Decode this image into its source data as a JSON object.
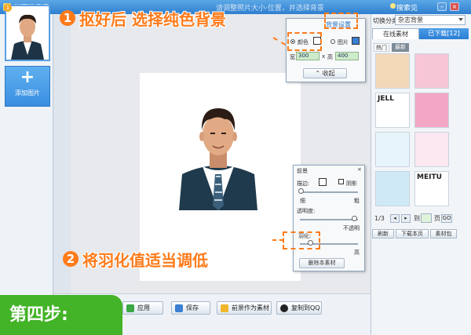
{
  "window": {
    "title": "抠图换背景",
    "center_hint": "请调整照片大小·位置，并选择背景",
    "help": "搜索见",
    "minimize": "–",
    "close": "×"
  },
  "left": {
    "badge": "1",
    "add_symbol": "+",
    "add_label": "添加图片"
  },
  "right": {
    "category_label": "切换分类",
    "category_value": "杂志背景",
    "tabs": [
      "在线素材",
      "已下载[12]"
    ],
    "subtabs": [
      "热门",
      "最新"
    ],
    "pager_text": "1/3",
    "prev": "◂",
    "next": "▸",
    "goto_label": "到",
    "page_label": "页",
    "go": "GO",
    "refresh": "刷新",
    "download_page": "下载本页",
    "pack": "素材包",
    "cover_colors": [
      "#f4d9b9",
      "#f6c6d6",
      "#ffffff",
      "#f3a7c5",
      "#e8f4fb",
      "#fbe8f0",
      "#cfe9f7",
      "#ffffff",
      "#86c340",
      "#ffd7e4",
      "#ffffff",
      "#f7e6b3"
    ],
    "cover_texts": [
      "",
      "",
      "JELL",
      "",
      "",
      "",
      "",
      "MEITU",
      "",
      "",
      "",
      ""
    ]
  },
  "bg_popup": {
    "title": "背景设置",
    "option_color": "颜色",
    "option_image": "图片",
    "width_label": "宽",
    "width_value": "300",
    "x_label": "x",
    "height_label": "高",
    "height_value": "400",
    "collapse": "收起"
  },
  "fg_popup": {
    "title": "前景",
    "border_label": "描边:",
    "shadow_label": "阴影",
    "thin": "细",
    "thick": "粗",
    "opacity_label": "透明度:",
    "opaque": "不透明",
    "feather_label": "羽化:",
    "feather_high": "高",
    "delete": "删除本素材",
    "close": "×"
  },
  "toolbar": {
    "apply": "应用",
    "save": "保存",
    "as_material": "前景作为素材",
    "copy_qq": "复制到QQ"
  },
  "annotations": {
    "step1_num": "1",
    "step1_text": "抠好后 选择纯色背景",
    "step2_num": "2",
    "step2_text": "将羽化值适当调低",
    "banner": "第四步:"
  },
  "colors": {
    "accent": "#ff7b1a",
    "banner": "#43b327",
    "title_bar": "#2f7fcf"
  }
}
